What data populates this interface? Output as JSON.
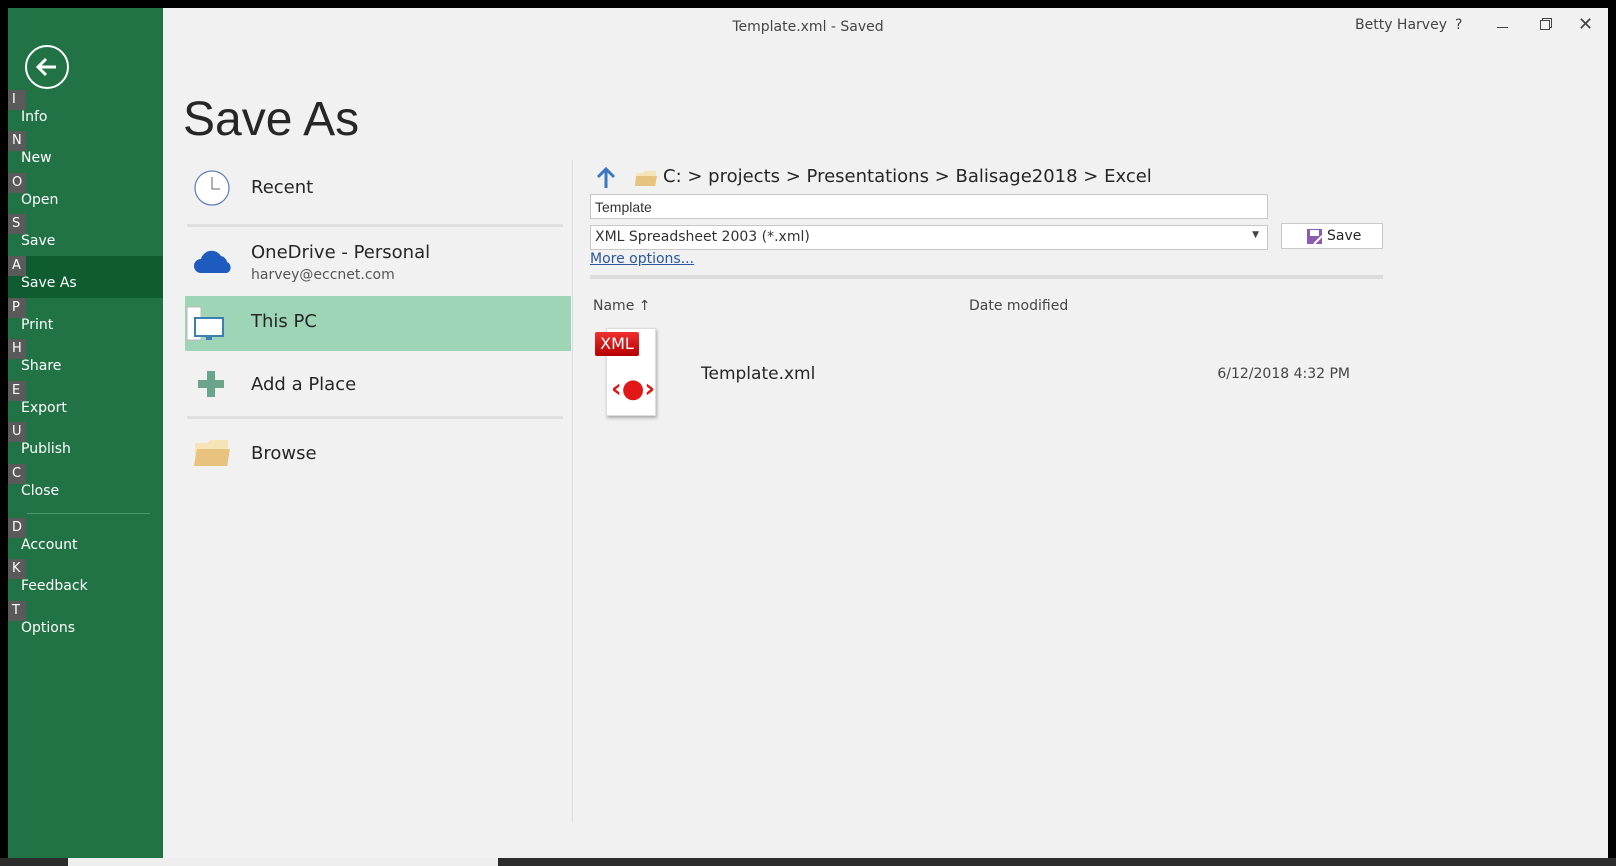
{
  "titlebar": {
    "title": "Template.xml  -  Saved",
    "user": "Betty Harvey",
    "help": "?"
  },
  "sidebar": {
    "items": [
      {
        "key": "I",
        "label": "Info"
      },
      {
        "key": "N",
        "label": "New"
      },
      {
        "key": "O",
        "label": "Open"
      },
      {
        "key": "S",
        "label": "Save"
      },
      {
        "key": "A",
        "label": "Save As"
      },
      {
        "key": "P",
        "label": "Print"
      },
      {
        "key": "H",
        "label": "Share"
      },
      {
        "key": "E",
        "label": "Export"
      },
      {
        "key": "U",
        "label": "Publish"
      },
      {
        "key": "C",
        "label": "Close"
      },
      {
        "key": "D",
        "label": "Account"
      },
      {
        "key": "K",
        "label": "Feedback"
      },
      {
        "key": "T",
        "label": "Options"
      }
    ],
    "active": "Save As"
  },
  "page": {
    "title": "Save As"
  },
  "places": {
    "recent": "Recent",
    "onedrive": "OneDrive - Personal",
    "onedrive_email": "harvey@eccnet.com",
    "this_pc": "This PC",
    "add_place": "Add a Place",
    "browse": "Browse"
  },
  "location": {
    "breadcrumb": "C: > projects > Presentations > Balisage2018 > Excel"
  },
  "form": {
    "filename": "Template",
    "filetype": "XML Spreadsheet 2003 (*.xml)",
    "save": "Save",
    "more_options": "More options..."
  },
  "files": {
    "columns": {
      "name": "Name",
      "date": "Date modified"
    },
    "sort_icon": "↑",
    "rows": [
      {
        "name": "Template.xml",
        "date": "6/12/2018 4:32 PM",
        "icon_label": "XML"
      }
    ]
  },
  "colors": {
    "brand": "#217346",
    "active": "#0e5c30",
    "selected": "#9fd5b7"
  }
}
